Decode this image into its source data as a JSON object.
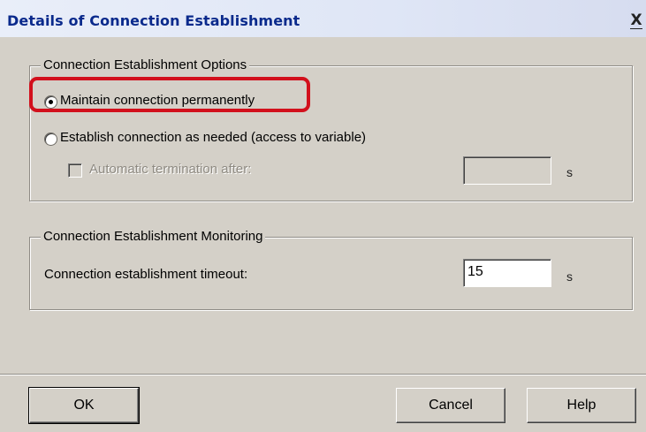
{
  "window": {
    "title": "Details of Connection Establishment",
    "close_symbol": "X"
  },
  "options_group": {
    "legend": "Connection Establishment Options",
    "radio_permanent": {
      "label": "Maintain connection permanently",
      "selected": true
    },
    "radio_as_needed": {
      "label": "Establish connection as needed (access to variable)",
      "selected": false
    },
    "auto_termination": {
      "label": "Automatic termination after:",
      "checked": false,
      "enabled": false,
      "value": "",
      "unit": "s"
    }
  },
  "monitoring_group": {
    "legend": "Connection Establishment Monitoring",
    "timeout_label": "Connection establishment timeout:",
    "timeout_value": "15",
    "unit": "s"
  },
  "buttons": {
    "ok": "OK",
    "cancel": "Cancel",
    "help": "Help"
  },
  "highlight_color": "#d2101c"
}
